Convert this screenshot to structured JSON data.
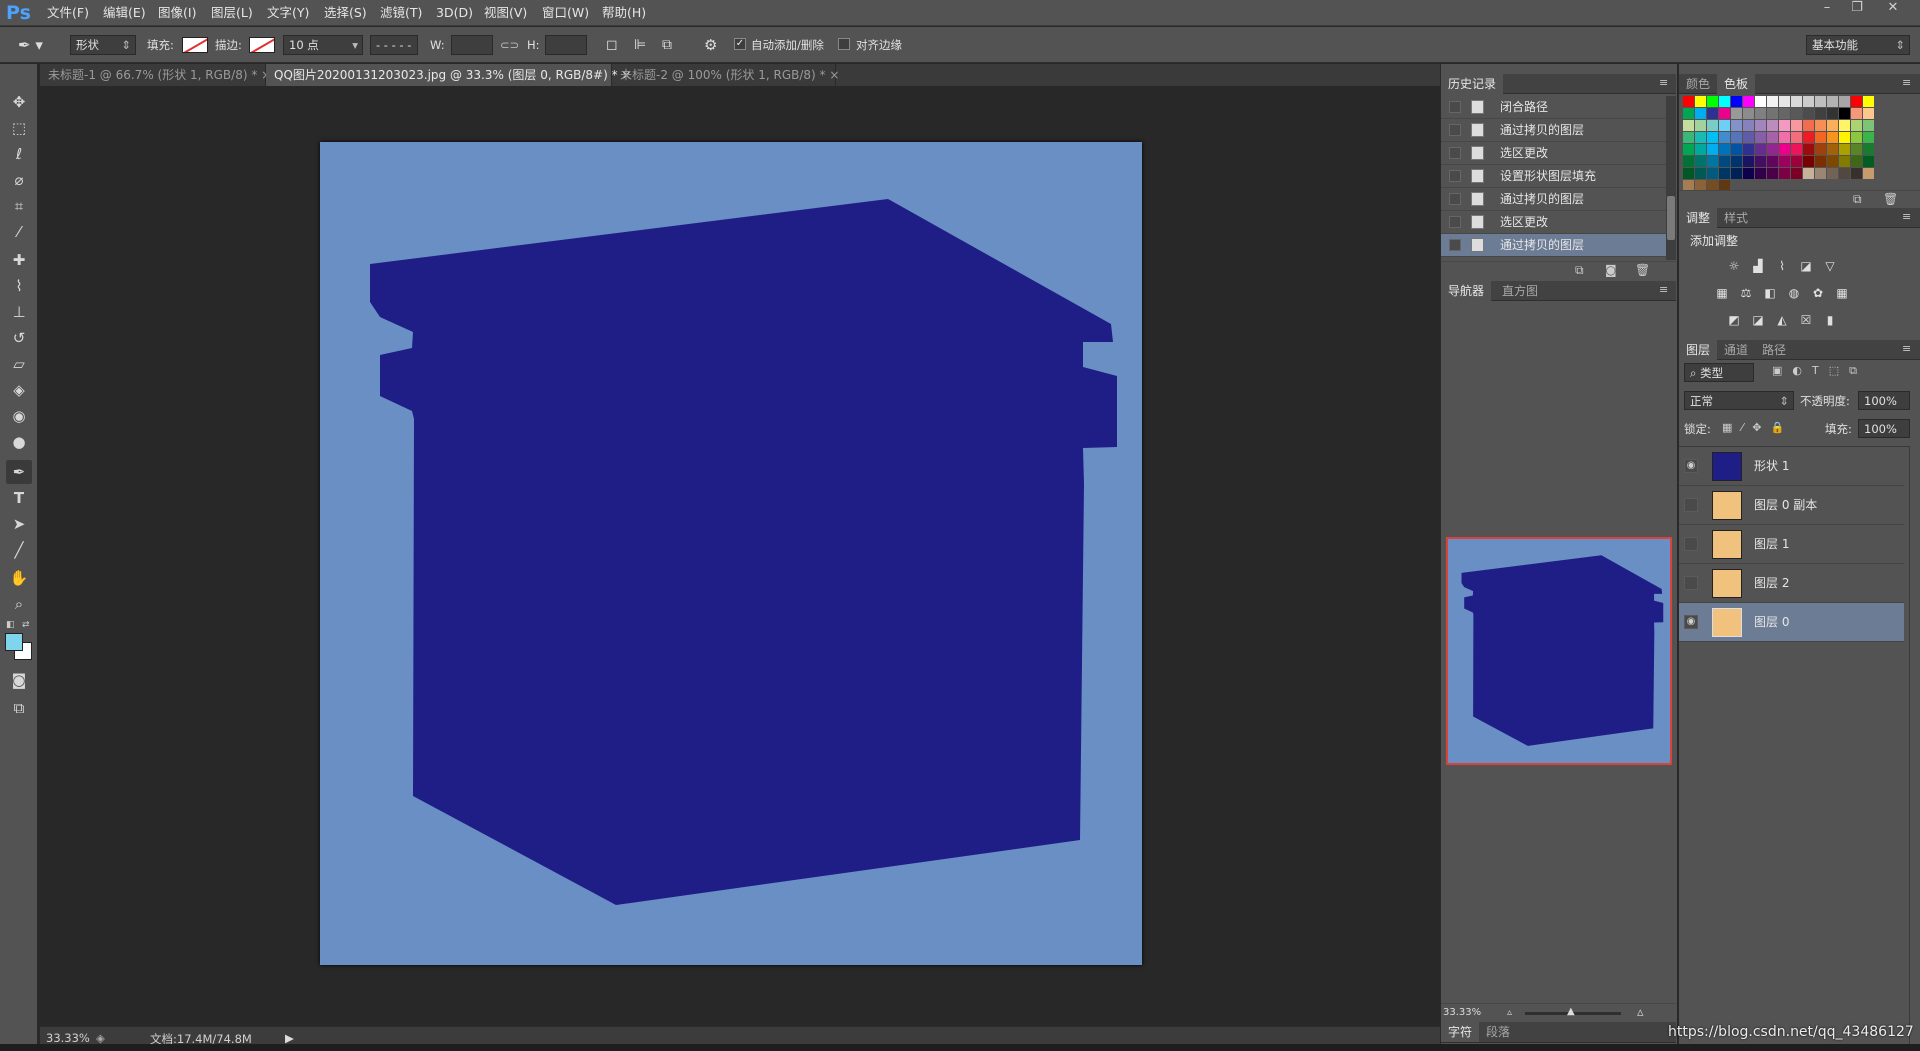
{
  "app": {
    "logo": "Ps"
  },
  "menubar": {
    "items": [
      "文件(F)",
      "编辑(E)",
      "图像(I)",
      "图层(L)",
      "文字(Y)",
      "选择(S)",
      "滤镜(T)",
      "3D(D)",
      "视图(V)",
      "窗口(W)",
      "帮助(H)"
    ]
  },
  "options": {
    "mode": "形状",
    "fill_label": "填充:",
    "stroke_label": "描边:",
    "stroke_size": "10 点",
    "w_label": "W:",
    "h_label": "H:",
    "auto_add_delete": "自动添加/删除",
    "align_edges": "对齐边缘",
    "workspace": "基本功能"
  },
  "tabs": [
    {
      "label": "未标题-1 @ 66.7% (形状 1, RGB/8) *",
      "close": "×"
    },
    {
      "label": "QQ图片20200131203023.jpg @ 33.3% (图层 0, RGB/8#) *",
      "close": "×"
    },
    {
      "label": "未标题-2 @ 100% (形状 1, RGB/8) *",
      "close": "×"
    }
  ],
  "status": {
    "zoom": "33.33%",
    "doc": "文档:17.4M/74.8M"
  },
  "history": {
    "tab_history": "历史记录",
    "items": [
      "闭合路径",
      "通过拷贝的图层",
      "选区更改",
      "设置形状图层填充",
      "通过拷贝的图层",
      "选区更改",
      "通过拷贝的图层"
    ]
  },
  "navigator": {
    "tab_navigator": "导航器",
    "tab_histogram": "直方图",
    "zoom": "33.33%"
  },
  "bottom_tabs": {
    "char": "字符",
    "para": "段落"
  },
  "swatches": {
    "tab_color": "颜色",
    "tab_swatches": "色板",
    "colors": [
      "#ff0000",
      "#ffff00",
      "#00ff00",
      "#00ffff",
      "#0000ff",
      "#ff00ff",
      "#ffffff",
      "#f2f2f2",
      "#e6e6e6",
      "#d9d9d9",
      "#cccccc",
      "#bfbfbf",
      "#b3b3b3",
      "#a6a6a6",
      "#ff0000",
      "#ffff00",
      "#00a651",
      "#00aeef",
      "#2e3192",
      "#ec008c",
      "#999999",
      "#8c8c8c",
      "#808080",
      "#737373",
      "#666666",
      "#595959",
      "#4d4d4d",
      "#404040",
      "#333333",
      "#000000",
      "#f7977a",
      "#fdc68a",
      "#c4df9b",
      "#a3d39c",
      "#7accc8",
      "#6dcff6",
      "#8393ca",
      "#8781bd",
      "#a186be",
      "#bd8cbf",
      "#f49ac2",
      "#f6989d",
      "#f26c4f",
      "#f68e55",
      "#fbaf5c",
      "#fff467",
      "#acd372",
      "#7cc576",
      "#3bb878",
      "#1abbb4",
      "#00bff3",
      "#438ccb",
      "#5574b9",
      "#605ca8",
      "#855fa8",
      "#a763a8",
      "#f06ea9",
      "#f26d7d",
      "#ed1c24",
      "#f26522",
      "#f7941d",
      "#fff200",
      "#8dc63f",
      "#39b54a",
      "#00a651",
      "#00a99d",
      "#00aeef",
      "#0072bc",
      "#0054a6",
      "#2e3192",
      "#662d91",
      "#92278f",
      "#ec008c",
      "#ed145b",
      "#9e0b0f",
      "#a0410d",
      "#a3620a",
      "#aba000",
      "#598527",
      "#197b30",
      "#007236",
      "#00746b",
      "#0076a3",
      "#004a80",
      "#003471",
      "#1b1464",
      "#440e62",
      "#630460",
      "#9e005d",
      "#9e0039",
      "#790000",
      "#7b2e00",
      "#7d4900",
      "#827b00",
      "#406618",
      "#005e20",
      "#005826",
      "#005952",
      "#005b7f",
      "#003663",
      "#002157",
      "#0d004c",
      "#32004b",
      "#4b0049",
      "#7b0046",
      "#7a0026",
      "#c7b299",
      "#998675",
      "#736357",
      "#534741",
      "#37302d",
      "#c69c6d",
      "#a67c52",
      "#8c6239",
      "#754c24",
      "#603913"
    ]
  },
  "adjustments": {
    "tab_adjust": "调整",
    "tab_styles": "样式",
    "title": "添加调整",
    "row1": [
      "brightness-icon",
      "levels-icon",
      "curves-icon",
      "exposure-icon",
      "vibrance-icon"
    ],
    "row2": [
      "hue-icon",
      "balance-icon",
      "bw-icon",
      "photofilter-icon",
      "mixer-icon",
      "lookup-icon"
    ],
    "row3": [
      "invert-icon",
      "posterize-icon",
      "threshold-icon",
      "selective-icon",
      "gradientmap-icon"
    ]
  },
  "layers": {
    "tab_layers": "图层",
    "tab_channels": "通道",
    "tab_paths": "路径",
    "filter": "类型",
    "blend": "正常",
    "opacity_label": "不透明度:",
    "opacity": "100%",
    "lock_label": "锁定:",
    "fill_label": "填充:",
    "fill": "100%",
    "items": [
      {
        "name": "形状 1",
        "visible": true,
        "selected": false
      },
      {
        "name": "图层 0 副本",
        "visible": false,
        "selected": false
      },
      {
        "name": "图层 1",
        "visible": false,
        "selected": false
      },
      {
        "name": "图层 2",
        "visible": false,
        "selected": false
      },
      {
        "name": "图层 0",
        "visible": true,
        "selected": true
      }
    ]
  },
  "colors": {
    "doc_bg": "#6a8fc4",
    "shape": "#1e1e86",
    "fg_swatch": "#7fd6ec",
    "bg_swatch": "#ffffff",
    "selected_row": "#6d7c95"
  },
  "watermark": "https://blog.csdn.net/qq_43486127"
}
